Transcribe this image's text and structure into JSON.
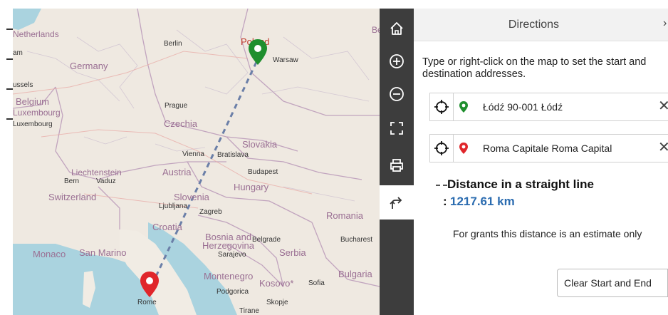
{
  "map": {
    "labels": {
      "netherlands": "Netherlands",
      "amsterdam_cut": "am",
      "belgium": "Belgium",
      "brussels_cut": "ussels",
      "luxembourg_country": "Luxembourg",
      "luxembourg_city": "Luxembourg",
      "germany": "Germany",
      "berlin": "Berlin",
      "poland": "Poland",
      "warsaw": "Warsaw",
      "prague": "Prague",
      "czechia": "Czechia",
      "slovakia": "Slovakia",
      "vienna": "Vienna",
      "bratislava": "Bratislava",
      "austria": "Austria",
      "budapest": "Budapest",
      "hungary": "Hungary",
      "liechtenstein": "Liechtenstein",
      "bern": "Bern",
      "vaduz": "Vaduz",
      "switzerland": "Switzerland",
      "slovenia": "Slovenia",
      "ljubljana": "Ljubljana",
      "zagreb": "Zagreb",
      "croatia": "Croatia",
      "romania": "Romania",
      "bosnia_line1": "Bosnia and",
      "bosnia_line2": "Herzegovina",
      "belgrade": "Belgrade",
      "bucharest": "Bucharest",
      "sarajevo": "Sarajevo",
      "serbia": "Serbia",
      "monaco": "Monaco",
      "san_marino": "San Marino",
      "montenegro": "Montenegro",
      "kosovo": "Kosovo*",
      "sofia": "Sofia",
      "bulgaria": "Bulgaria",
      "podgorica": "Podgorica",
      "skopje": "Skopje",
      "rome": "Rome",
      "tirane": "Tirane",
      "belarus_cut": "Be"
    },
    "route_color": "#6b7fa8",
    "start_pin_color": "#1f8f2e",
    "end_pin_color": "#e0262b"
  },
  "toolbar": {
    "buttons": [
      "home-icon",
      "zoom-in-icon",
      "zoom-out-icon",
      "fullscreen-icon",
      "print-icon",
      "directions-icon"
    ]
  },
  "panel": {
    "title": "Directions",
    "instructions": "Type or right-click on the map to set the start and destination addresses.",
    "start_address": "Łódź 90-001 Łódź",
    "end_address": "Roma Capitale  Roma Capital",
    "distance_title": "Distance in a straight line",
    "distance_colon": ":",
    "distance_value": "1217.61 km",
    "note": "For grants this distance is an estimate only",
    "clear_button": "Clear Start and End",
    "start_pin_color": "#1f8f2e",
    "end_pin_color": "#e0262b",
    "accent": "#2b6cb0"
  }
}
